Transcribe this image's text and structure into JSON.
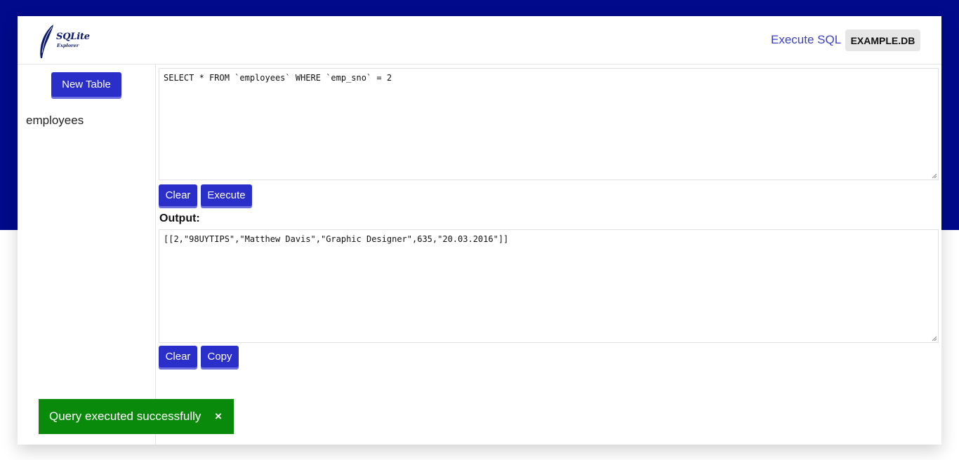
{
  "header": {
    "logo_title": "SQLite",
    "logo_subtitle": "Explorer",
    "nav_execute": "Execute SQL",
    "database_name": "EXAMPLE.DB"
  },
  "sidebar": {
    "new_table_label": "New Table",
    "tables": [
      "employees"
    ]
  },
  "query": {
    "sql": "SELECT * FROM `employees` WHERE `emp_sno` = 2",
    "clear_label": "Clear",
    "execute_label": "Execute"
  },
  "output": {
    "label": "Output:",
    "text": "[[2,\"98UYTIPS\",\"Matthew Davis\",\"Graphic Designer\",635,\"20.03.2016\"]]",
    "clear_label": "Clear",
    "copy_label": "Copy"
  },
  "toast": {
    "message": "Query executed successfully",
    "close": "×"
  },
  "colors": {
    "brand_blue": "#000a8a",
    "button": "#2b2fc9",
    "success": "#0a8a0a"
  }
}
